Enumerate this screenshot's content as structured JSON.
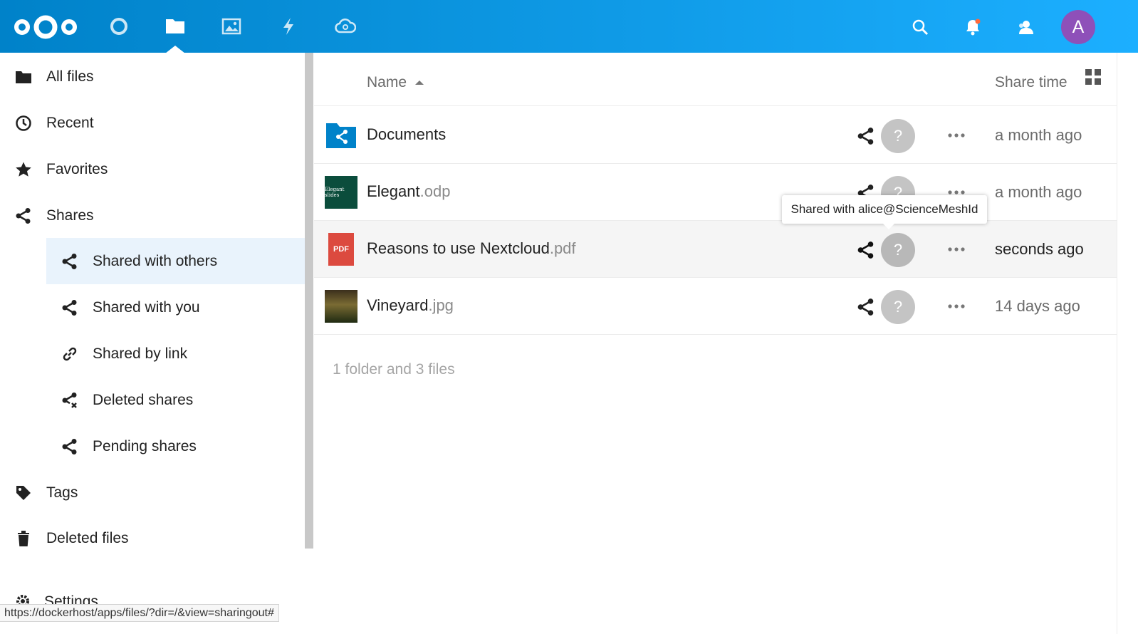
{
  "header": {
    "apps": [
      {
        "name": "dashboard",
        "icon": "circle-icon"
      },
      {
        "name": "files",
        "icon": "folder-icon",
        "active": true
      },
      {
        "name": "photos",
        "icon": "image-icon"
      },
      {
        "name": "activity",
        "icon": "lightning-icon"
      },
      {
        "name": "federation",
        "icon": "cloud-icon"
      }
    ],
    "right": [
      "search-icon",
      "bell-icon",
      "contacts-icon"
    ],
    "avatar_letter": "A",
    "avatar_color": "#8e50b9",
    "gradient_start": "#0082c9",
    "gradient_end": "#1cafff"
  },
  "sidebar": {
    "items": [
      {
        "label": "All files",
        "icon": "folder-icon"
      },
      {
        "label": "Recent",
        "icon": "clock-icon"
      },
      {
        "label": "Favorites",
        "icon": "star-icon"
      },
      {
        "label": "Shares",
        "icon": "share-icon"
      },
      {
        "label": "Shared with others",
        "icon": "share-icon",
        "active": true
      },
      {
        "label": "Shared with you",
        "icon": "share-icon"
      },
      {
        "label": "Shared by link",
        "icon": "link-icon"
      },
      {
        "label": "Deleted shares",
        "icon": "deleted-share-icon"
      },
      {
        "label": "Pending shares",
        "icon": "share-icon"
      },
      {
        "label": "Tags",
        "icon": "tag-icon"
      },
      {
        "label": "Deleted files",
        "icon": "trash-icon"
      }
    ],
    "settings_label": "Settings"
  },
  "status_url": "https://dockerhost/apps/files/?dir=/&view=sharingout#",
  "files": {
    "columns": {
      "name": "Name",
      "share_time": "Share time"
    },
    "rows": [
      {
        "base": "Documents",
        "ext": "",
        "time": "a month ago",
        "owner": "?"
      },
      {
        "base": "Elegant",
        "ext": ".odp",
        "time": "a month ago",
        "owner": "?"
      },
      {
        "base": "Reasons to use Nextcloud",
        "ext": ".pdf",
        "time": "seconds ago",
        "owner": "?"
      },
      {
        "base": "Vineyard",
        "ext": ".jpg",
        "time": "14 days ago",
        "owner": "?"
      }
    ],
    "thumb_labels": {
      "odp": "Elegant slides",
      "pdf": "PDF"
    },
    "summary": "1 folder and 3 files"
  },
  "tooltip": "Shared with alice@ScienceMeshId"
}
